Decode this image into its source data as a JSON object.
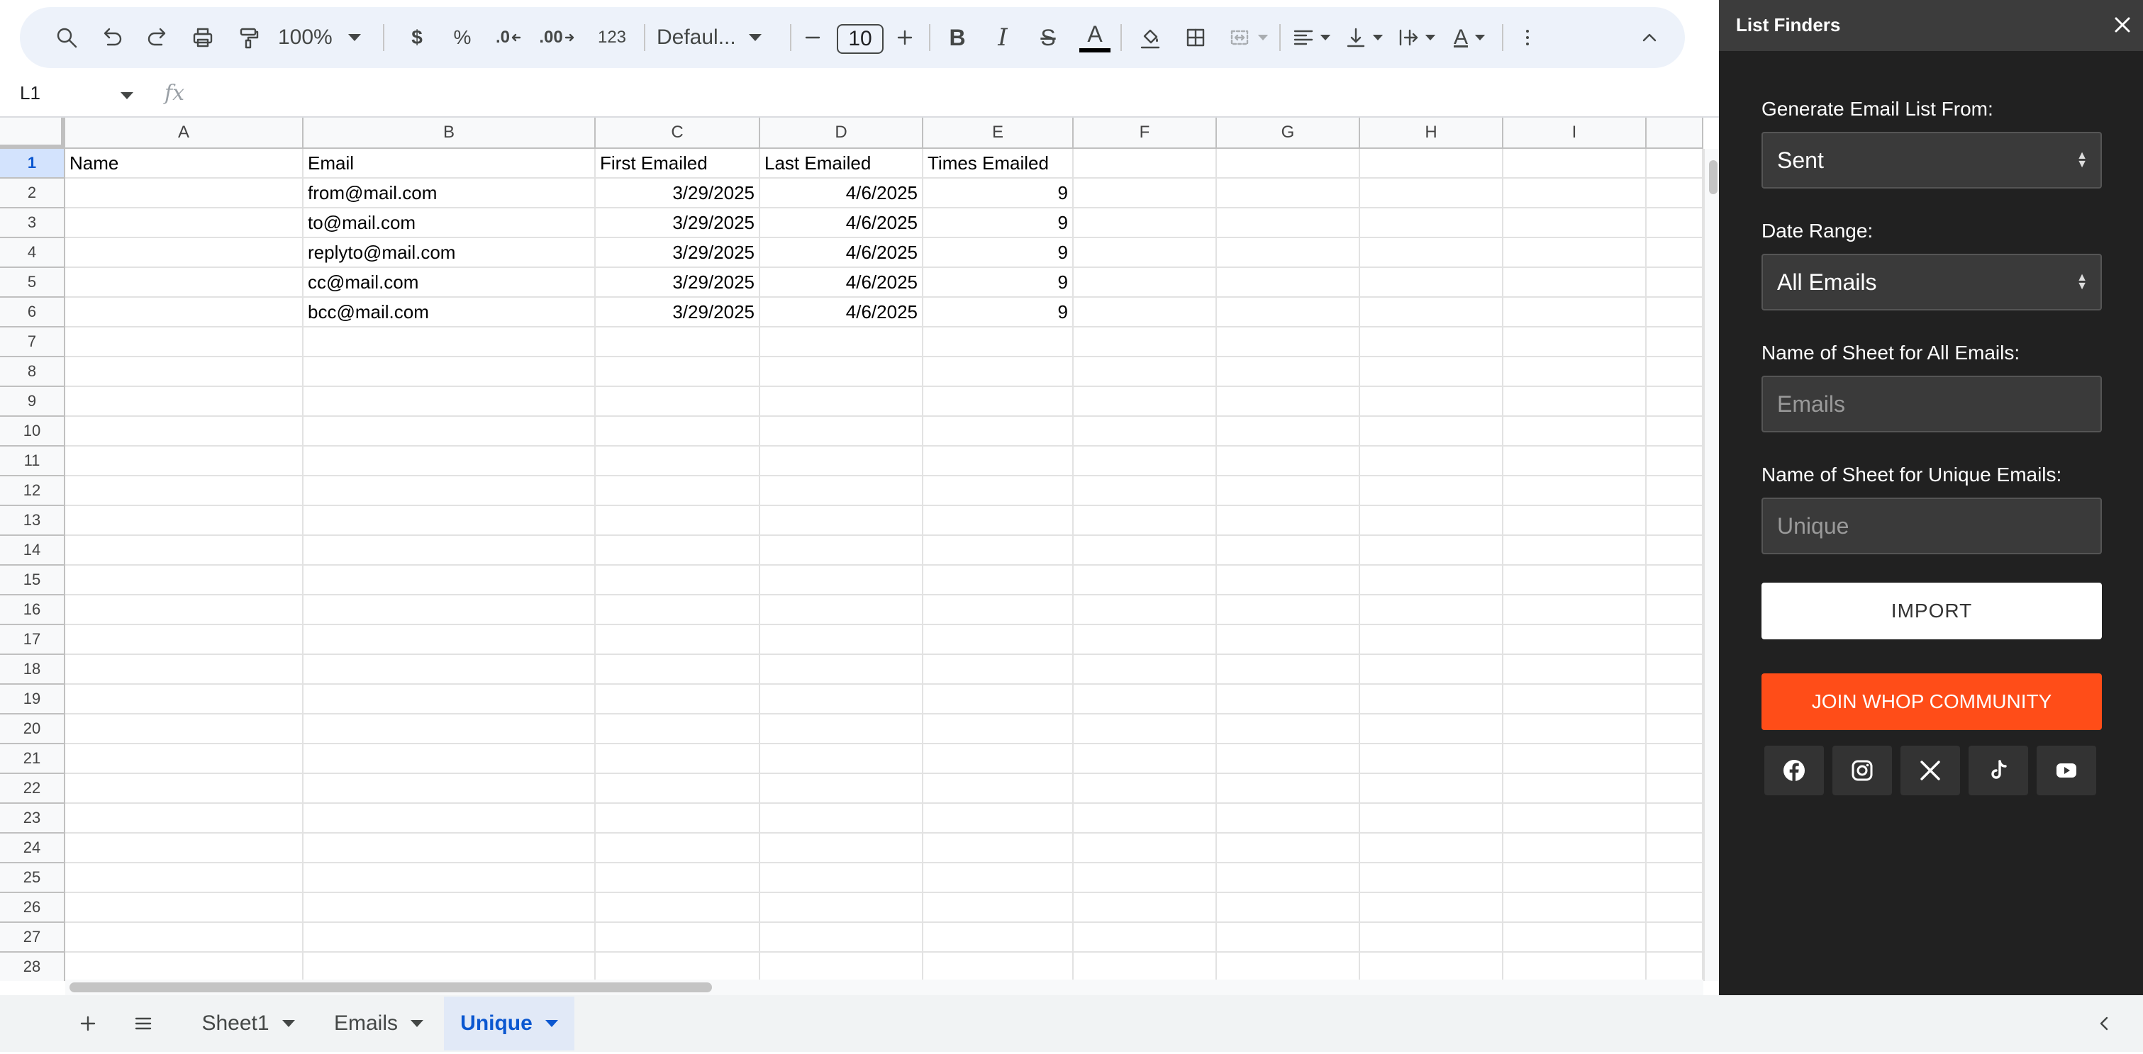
{
  "toolbar": {
    "zoom": "100%",
    "currency_label": "$",
    "percent_label": "%",
    "decrease_decimal_label": ".0",
    "increase_decimal_label": ".00",
    "number_format_label": "123",
    "font_name": "Defaul...",
    "font_size": "10",
    "text_color": "#000000"
  },
  "formula_bar": {
    "name_box": "L1",
    "fx_label": "fx"
  },
  "grid": {
    "columns": [
      "A",
      "B",
      "C",
      "D",
      "E",
      "F",
      "G",
      "H",
      "I"
    ],
    "row_numbers": [
      "1",
      "2",
      "3",
      "4",
      "5",
      "6",
      "7",
      "8",
      "9",
      "10",
      "11",
      "12",
      "13",
      "14",
      "15",
      "16",
      "17",
      "18",
      "19",
      "20",
      "21",
      "22",
      "23",
      "24",
      "25",
      "26",
      "27",
      "28"
    ],
    "header_row": {
      "A": "Name",
      "B": "Email",
      "C": "First Emailed",
      "D": "Last Emailed",
      "E": "Times Emailed"
    },
    "rows": [
      {
        "email": "from@mail.com",
        "first": "3/29/2025",
        "last": "4/6/2025",
        "times": "9"
      },
      {
        "email": "to@mail.com",
        "first": "3/29/2025",
        "last": "4/6/2025",
        "times": "9"
      },
      {
        "email": "replyto@mail.com",
        "first": "3/29/2025",
        "last": "4/6/2025",
        "times": "9"
      },
      {
        "email": "cc@mail.com",
        "first": "3/29/2025",
        "last": "4/6/2025",
        "times": "9"
      },
      {
        "email": "bcc@mail.com",
        "first": "3/29/2025",
        "last": "4/6/2025",
        "times": "9"
      }
    ]
  },
  "sheet_tabs": {
    "tabs": [
      {
        "label": "Sheet1",
        "active": false
      },
      {
        "label": "Emails",
        "active": false
      },
      {
        "label": "Unique",
        "active": true
      }
    ]
  },
  "panel": {
    "title": "List Finders",
    "generate_label": "Generate Email List From:",
    "generate_value": "Sent",
    "date_range_label": "Date Range:",
    "date_range_value": "All Emails",
    "all_sheet_label": "Name of Sheet for All Emails:",
    "all_sheet_placeholder": "Emails",
    "unique_sheet_label": "Name of Sheet for Unique Emails:",
    "unique_sheet_placeholder": "Unique",
    "import_label": "IMPORT",
    "community_label": "JOIN WHOP COMMUNITY",
    "community_color": "#ff4d18",
    "socials": [
      "facebook-icon",
      "instagram-icon",
      "x-icon",
      "tiktok-icon",
      "youtube-icon"
    ]
  }
}
